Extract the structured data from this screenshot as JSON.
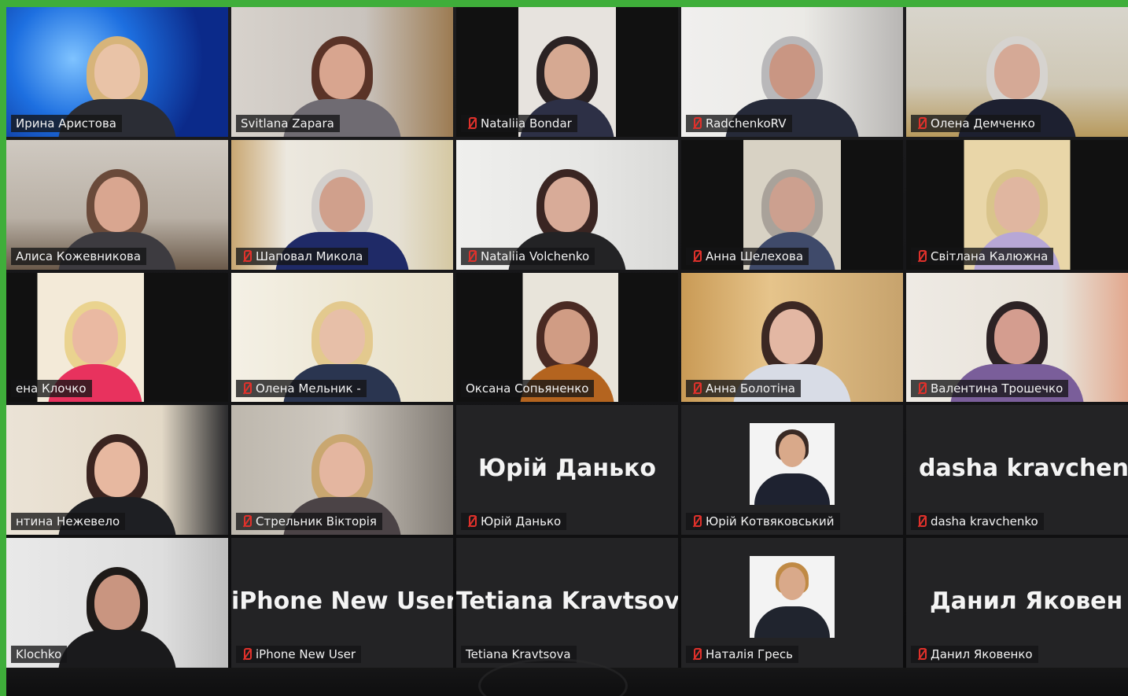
{
  "participants": [
    {
      "name": "Ирина Аристова"
    },
    {
      "name": "Svitlana Zapara"
    },
    {
      "name": "Nataliia Bondar"
    },
    {
      "name": "RadchenkoRV"
    },
    {
      "name": "Олена Демченко"
    },
    {
      "name": "Алиса Кожевникова"
    },
    {
      "name": "Шаповал Микола"
    },
    {
      "name": "Nataliia Volchenko"
    },
    {
      "name": "Анна Шелехова"
    },
    {
      "name": "Світлана Калюжна"
    },
    {
      "name": "ена Клочко"
    },
    {
      "name": "Олена Мельник -"
    },
    {
      "name": "Оксана Сопьяненко"
    },
    {
      "name": "Анна Болотіна"
    },
    {
      "name": "Валентина Трошечко"
    },
    {
      "name": "нтина Нежевело"
    },
    {
      "name": "Стрельник Вікторія"
    },
    {
      "name": "Юрій Данько",
      "display": "Юрій Данько"
    },
    {
      "name": "Юрій Котвяковський"
    },
    {
      "name": "dasha kravchenko",
      "display": "dasha kravchenk"
    },
    {
      "name": "Klochko"
    },
    {
      "name": "iPhone New User",
      "display": "iPhone New User"
    },
    {
      "name": "Tetiana Kravtsova",
      "display": "Tetiana Kravtsova"
    },
    {
      "name": "Наталія Гресь"
    },
    {
      "name": "Данил Яковенко",
      "display": "Данил Яковен"
    }
  ],
  "colors": {
    "frame": "#3fae3a",
    "active_speaker_outline": "#c7d63a",
    "muted_icon": "#e0312b"
  },
  "icons": {
    "muted": "mic-muted-icon"
  }
}
